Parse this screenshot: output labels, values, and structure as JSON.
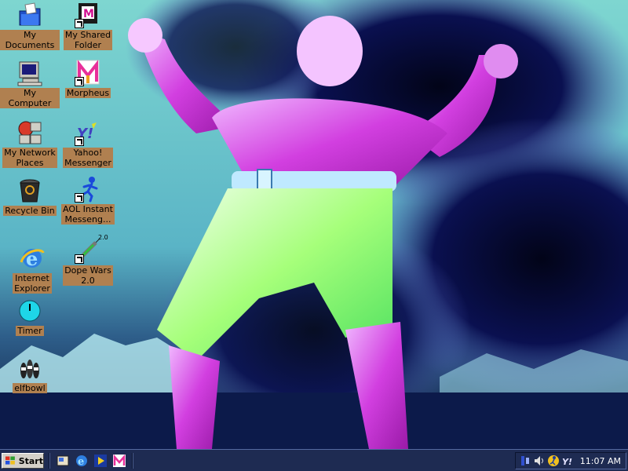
{
  "desktop": {
    "icons": [
      {
        "label": "My Documents"
      },
      {
        "label": "My Computer"
      },
      {
        "label": "My Network\nPlaces"
      },
      {
        "label": "Recycle Bin"
      },
      {
        "label": "Internet\nExplorer"
      },
      {
        "label": "Timer"
      },
      {
        "label": "elfbowl"
      },
      {
        "label": "My Shared\nFolder"
      },
      {
        "label": "Morpheus"
      },
      {
        "label": "Yahoo!\nMessenger"
      },
      {
        "label": "AOL Instant\nMesseng..."
      },
      {
        "label": "Dope Wars\n2.0"
      }
    ],
    "dopewars_badge": "2.0"
  },
  "taskbar": {
    "start_label": "Start",
    "clock": "11:07 AM"
  },
  "colors": {
    "taskbar": "#1e2b52",
    "label_bg": "#b08050",
    "desktop": "#5fb7c4"
  }
}
